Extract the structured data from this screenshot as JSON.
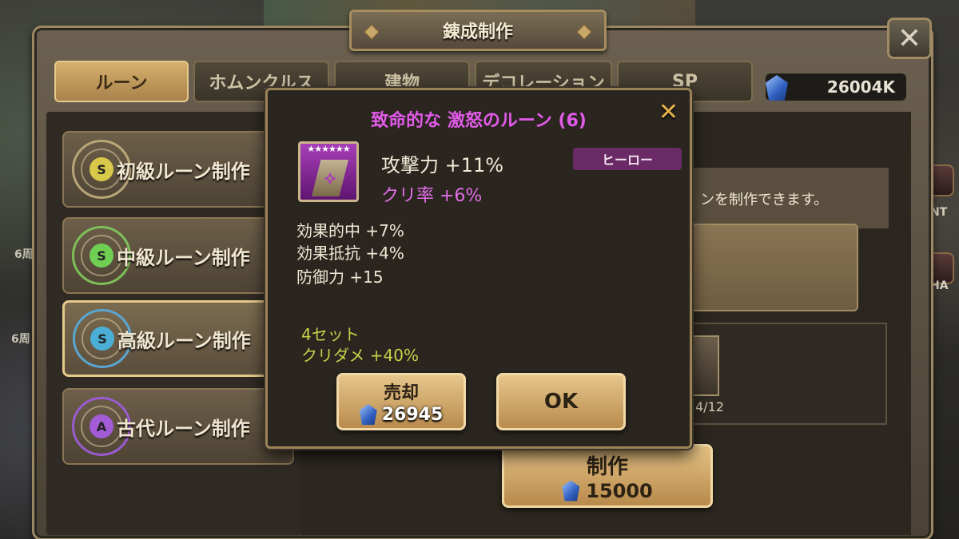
{
  "window": {
    "title": "錬成制作"
  },
  "tabs": [
    {
      "label": "ルーン",
      "active": true
    },
    {
      "label": "ホムンクルス",
      "active": false
    },
    {
      "label": "建物",
      "active": false
    },
    {
      "label": "デコレーション",
      "active": false
    },
    {
      "label": "SP",
      "active": false
    }
  ],
  "currency": {
    "amount": "26004K",
    "icon": "crystal-gem"
  },
  "rune_list": [
    {
      "label": "初級ルーン制作",
      "core_color": "#d9c94a",
      "ring_color": "#b9a678",
      "symbol": "S"
    },
    {
      "label": "中級ルーン制作",
      "core_color": "#6fcf52",
      "ring_color": "#7fbf5a",
      "symbol": "S"
    },
    {
      "label": "高級ルーン制作",
      "core_color": "#4aaed6",
      "ring_color": "#5aa6d0",
      "symbol": "S"
    },
    {
      "label": "古代ルーン制作",
      "core_color": "#a35bd6",
      "ring_color": "#9a5ccf",
      "symbol": "A"
    }
  ],
  "side_labels": {
    "left_a": "6周",
    "left_b": "6周",
    "right_a": "NT",
    "right_b": "HA"
  },
  "description": {
    "text": "ンを制作できます。"
  },
  "material": {
    "count": "4/12"
  },
  "craft": {
    "label": "制作",
    "cost": "15000"
  },
  "modal": {
    "title": "致命的な 激怒のルーン (6)",
    "stars": "★★★★★★",
    "grade": "ヒーロー",
    "main_stat": "攻撃力 +11%",
    "innate_stat": "クリ率 +6%",
    "sub_stats": [
      "効果的中 +7%",
      "効果抵抗 +4%",
      "防御力 +15"
    ],
    "set": {
      "line1": "4セット",
      "line2": "クリダメ +40%"
    },
    "sell": {
      "label": "売却",
      "price": "26945"
    },
    "ok": {
      "label": "OK"
    },
    "colors": {
      "title": "#e25be9",
      "innate": "#e06ee6",
      "set": "#c5d24b",
      "grade_bg": "#6a2a66"
    }
  }
}
